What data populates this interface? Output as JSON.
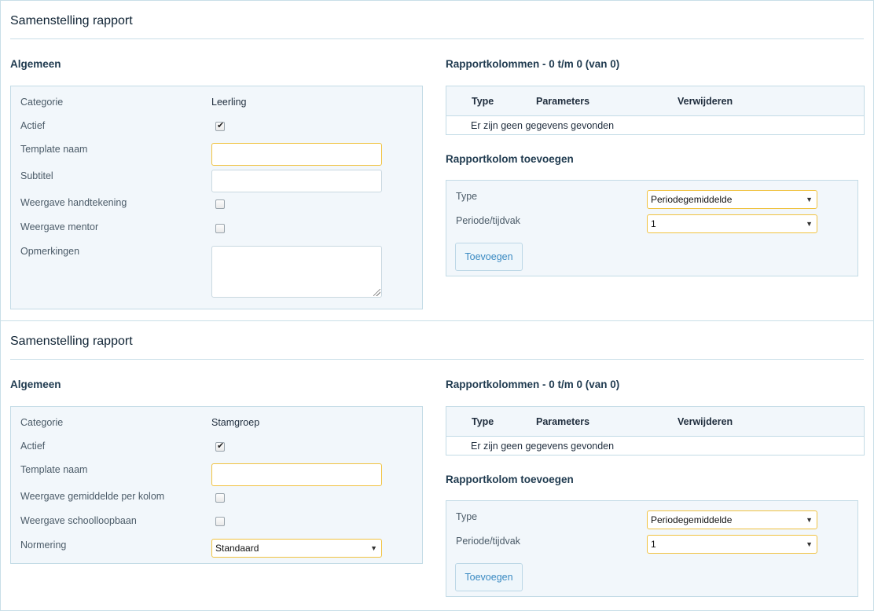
{
  "panels": [
    {
      "title": "Samenstelling rapport",
      "general": {
        "heading": "Algemeen",
        "categorie_label": "Categorie",
        "categorie_value": "Leerling",
        "actief_label": "Actief",
        "actief_checked": true,
        "template_label": "Template naam",
        "template_value": "",
        "subtitel_label": "Subtitel",
        "subtitel_value": "",
        "handtekening_label": "Weergave handtekening",
        "handtekening_checked": false,
        "mentor_label": "Weergave mentor",
        "mentor_checked": false,
        "opmerkingen_label": "Opmerkingen",
        "opmerkingen_value": ""
      },
      "columns": {
        "heading": "Rapportkolommen - 0 t/m 0 (van 0)",
        "headers": [
          "Type",
          "Parameters",
          "Verwijderen"
        ],
        "empty_text": "Er zijn geen gegevens gevonden"
      },
      "add": {
        "heading": "Rapportkolom toevoegen",
        "type_label": "Type",
        "type_value": "Periodegemiddelde",
        "periode_label": "Periode/tijdvak",
        "periode_value": "1",
        "button_label": "Toevoegen"
      }
    },
    {
      "title": "Samenstelling rapport",
      "general": {
        "heading": "Algemeen",
        "categorie_label": "Categorie",
        "categorie_value": "Stamgroep",
        "actief_label": "Actief",
        "actief_checked": true,
        "template_label": "Template naam",
        "template_value": "",
        "gemiddelde_label": "Weergave gemiddelde per kolom",
        "gemiddelde_checked": false,
        "schoolloopbaan_label": "Weergave schoolloopbaan",
        "schoolloopbaan_checked": false,
        "normering_label": "Normering",
        "normering_value": "Standaard"
      },
      "columns": {
        "heading": "Rapportkolommen - 0 t/m 0 (van 0)",
        "headers": [
          "Type",
          "Parameters",
          "Verwijderen"
        ],
        "empty_text": "Er zijn geen gegevens gevonden"
      },
      "add": {
        "heading": "Rapportkolom toevoegen",
        "type_label": "Type",
        "type_value": "Periodegemiddelde",
        "periode_label": "Periode/tijdvak",
        "periode_value": "1",
        "button_label": "Toevoegen"
      }
    }
  ],
  "icons": {
    "checkmark": "check-icon",
    "dropdown": "chevron-down-icon",
    "resize": "resize-grip-icon"
  }
}
